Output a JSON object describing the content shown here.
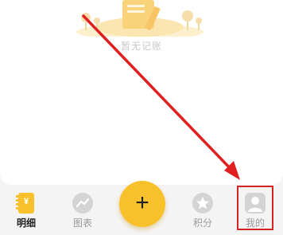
{
  "empty_state": {
    "text": "暂无记账",
    "illustration": "empty-ledger-illustration"
  },
  "add_button": {
    "label": "+"
  },
  "tabs": [
    {
      "id": "detail",
      "label": "明细",
      "icon": "ledger-icon",
      "icon_text": "¥",
      "active": true
    },
    {
      "id": "chart",
      "label": "图表",
      "icon": "chart-icon",
      "active": false
    },
    {
      "id": "points",
      "label": "积分",
      "icon": "star-icon",
      "active": false
    },
    {
      "id": "mine",
      "label": "我的",
      "icon": "person-icon",
      "active": false
    }
  ],
  "colors": {
    "accent": "#f8c12c",
    "annotation": "#e02020",
    "active_label": "#222222",
    "inactive_label": "#9a9a9a"
  }
}
